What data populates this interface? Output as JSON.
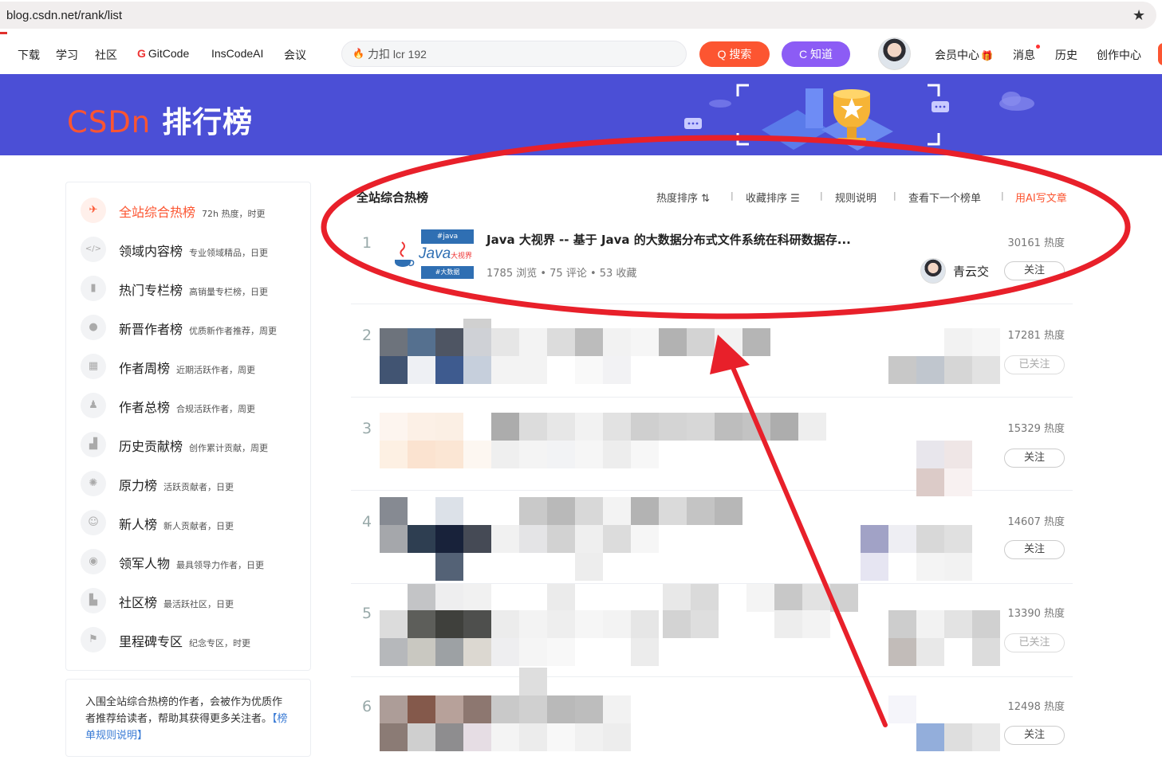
{
  "browser": {
    "url": "blog.csdn.net/rank/list",
    "star_icon": "star-icon"
  },
  "toolbar": {
    "nav": [
      "下载",
      "学习",
      "社区",
      "GitCode",
      "InsCodeAI",
      "会议"
    ],
    "search_placeholder": "力扣 lcr 192",
    "search_button": "Q 搜索",
    "zhidao_button": "C 知道",
    "right_links": [
      "会员中心",
      "消息",
      "历史",
      "创作中心"
    ]
  },
  "banner": {
    "logo_brand": "CSDn",
    "logo_title": "排行榜"
  },
  "sidebar": {
    "items": [
      {
        "label": "全站综合热榜",
        "desc": "72h 热度，时更",
        "icon": "rocket-icon",
        "glyph": "✈",
        "active": true
      },
      {
        "label": "领域内容榜",
        "desc": "专业领域精品，日更",
        "icon": "code-icon",
        "glyph": "</>",
        "active": false
      },
      {
        "label": "热门专栏榜",
        "desc": "高销量专栏榜，日更",
        "icon": "bookmark-icon",
        "glyph": "▮",
        "active": false
      },
      {
        "label": "新晋作者榜",
        "desc": "优质新作者推荐，周更",
        "icon": "user-icon",
        "glyph": "●",
        "active": false
      },
      {
        "label": "作者周榜",
        "desc": "近期活跃作者，周更",
        "icon": "calendar-icon",
        "glyph": "▦",
        "active": false
      },
      {
        "label": "作者总榜",
        "desc": "合规活跃作者，周更",
        "icon": "users-icon",
        "glyph": "♟",
        "active": false
      },
      {
        "label": "历史贡献榜",
        "desc": "创作累计贡献，周更",
        "icon": "podium-icon",
        "glyph": "▟",
        "active": false
      },
      {
        "label": "原力榜",
        "desc": "活跃贡献者，日更",
        "icon": "force-icon",
        "glyph": "✺",
        "active": false
      },
      {
        "label": "新人榜",
        "desc": "新人贡献者，日更",
        "icon": "newbie-icon",
        "glyph": "☺",
        "active": false
      },
      {
        "label": "领军人物",
        "desc": "最具领导力作者，日更",
        "icon": "medal-icon",
        "glyph": "◉",
        "active": false
      },
      {
        "label": "社区榜",
        "desc": "最活跃社区，日更",
        "icon": "community-icon",
        "glyph": "▙",
        "active": false
      },
      {
        "label": "里程碑专区",
        "desc": "纪念专区，时更",
        "icon": "milestone-icon",
        "glyph": "⚑",
        "active": false
      }
    ],
    "note_text": "入围全站综合热榜的作者，会被作为优质作者推荐给读者，帮助其获得更多关注者。",
    "note_link": "【榜单规则说明】"
  },
  "list": {
    "title": "全站综合热榜",
    "sort_options": [
      "热度排序",
      "收藏排序",
      "规则说明",
      "查看下一个榜单"
    ],
    "ai_link": "用AI写文章",
    "first": {
      "rank": "1",
      "title": "Java 大视界 -- 基于 Java 的大数据分布式文件系统在科研数据存...",
      "thumb_top": "#java",
      "thumb_word": "Java",
      "thumb_small": "大视界",
      "thumb_bottom": "#大数据",
      "meta": "1785 浏览 • 75 评论 • 53 收藏",
      "author": "青云交",
      "heat": "30161 热度",
      "follow": "关注"
    },
    "rows": [
      {
        "rank": "2",
        "heat": "17281 热度",
        "follow": "已关注",
        "followed": true
      },
      {
        "rank": "3",
        "heat": "15329 热度",
        "follow": "关注",
        "followed": false
      },
      {
        "rank": "4",
        "heat": "14607 热度",
        "follow": "关注",
        "followed": false
      },
      {
        "rank": "5",
        "heat": "13390 热度",
        "follow": "已关注",
        "followed": true
      },
      {
        "rank": "6",
        "heat": "12498 热度",
        "follow": "关注",
        "followed": false
      }
    ]
  },
  "colors": {
    "accent": "#fc5531",
    "banner": "#4b4fd6",
    "annotation": "#e8202a"
  }
}
